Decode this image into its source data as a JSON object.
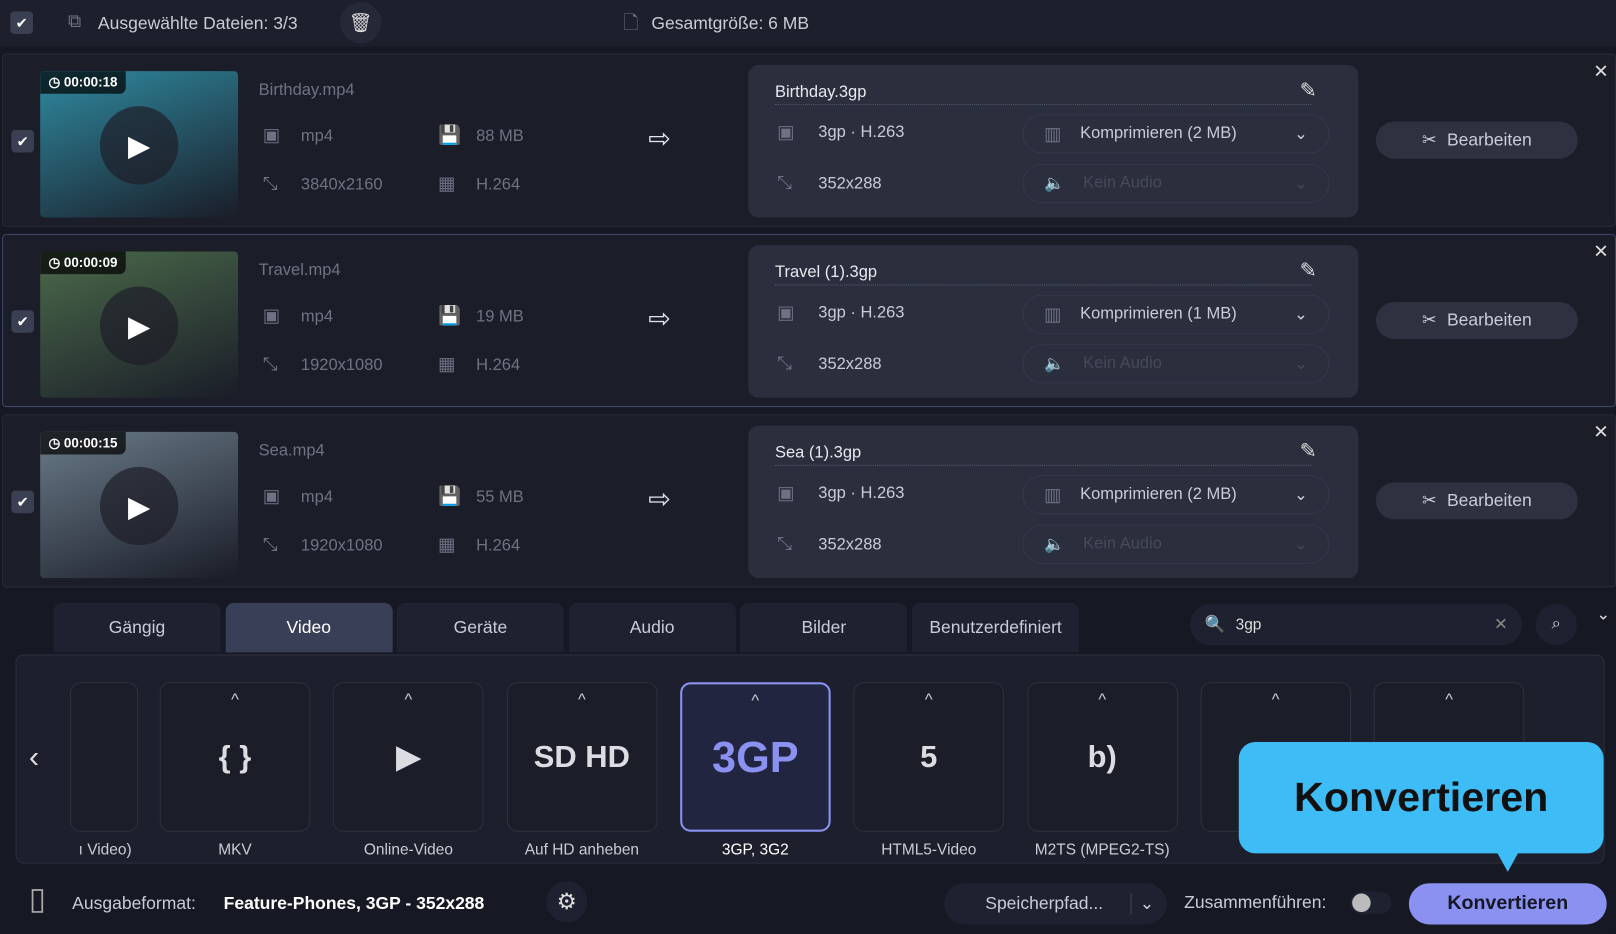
{
  "topbar": {
    "selected": "Ausgewählte Dateien: 3/3",
    "total": "Gesamtgröße: 6 MB"
  },
  "files": [
    {
      "duration": "00:00:18",
      "name": "Birthday.mp4",
      "format": "mp4",
      "size": "88 MB",
      "resolution": "3840x2160",
      "codec": "H.264",
      "out_name": "Birthday.3gp",
      "out_format": "3gp · H.263",
      "out_res": "352x288",
      "compress": "Komprimieren (2 MB)",
      "audio": "Kein Audio",
      "edit": "Bearbeiten",
      "thumb_color": "#2f8aa0"
    },
    {
      "duration": "00:00:09",
      "name": "Travel.mp4",
      "format": "mp4",
      "size": "19 MB",
      "resolution": "1920x1080",
      "codec": "H.264",
      "out_name": "Travel (1).3gp",
      "out_format": "3gp · H.263",
      "out_res": "352x288",
      "compress": "Komprimieren (1 MB)",
      "audio": "Kein Audio",
      "edit": "Bearbeiten",
      "thumb_color": "#4b6a4a"
    },
    {
      "duration": "00:00:15",
      "name": "Sea.mp4",
      "format": "mp4",
      "size": "55 MB",
      "resolution": "1920x1080",
      "codec": "H.264",
      "out_name": "Sea (1).3gp",
      "out_format": "3gp · H.263",
      "out_res": "352x288",
      "compress": "Komprimieren (2 MB)",
      "audio": "Kein Audio",
      "edit": "Bearbeiten",
      "thumb_color": "#6a7b88"
    }
  ],
  "tabs": [
    "Gängig",
    "Video",
    "Geräte",
    "Audio",
    "Bilder",
    "Benutzerdefiniert"
  ],
  "search": {
    "value": "3gp"
  },
  "formats": [
    {
      "label": "ı Video)",
      "glyph": ""
    },
    {
      "label": "MKV",
      "glyph": "{ }"
    },
    {
      "label": "Online-Video",
      "glyph": "▶"
    },
    {
      "label": "Auf HD anheben",
      "glyph": "SD HD"
    },
    {
      "label": "3GP, 3G2",
      "glyph": "3GP"
    },
    {
      "label": "HTML5-Video",
      "glyph": "5"
    },
    {
      "label": "M2TS (MPEG2-TS)",
      "glyph": "b)"
    },
    {
      "label": "",
      "glyph": ""
    },
    {
      "label": "",
      "glyph": ""
    }
  ],
  "tooltip": "Konvertieren",
  "footer": {
    "label": "Ausgabeformat:",
    "value": "Feature-Phones, 3GP - 352x288",
    "save": "Speicherpfad...",
    "merge": "Zusammenführen:",
    "convert": "Konvertieren"
  },
  "colors": {
    "accent": "#8b91f0",
    "tooltip": "#3dbcf5"
  }
}
